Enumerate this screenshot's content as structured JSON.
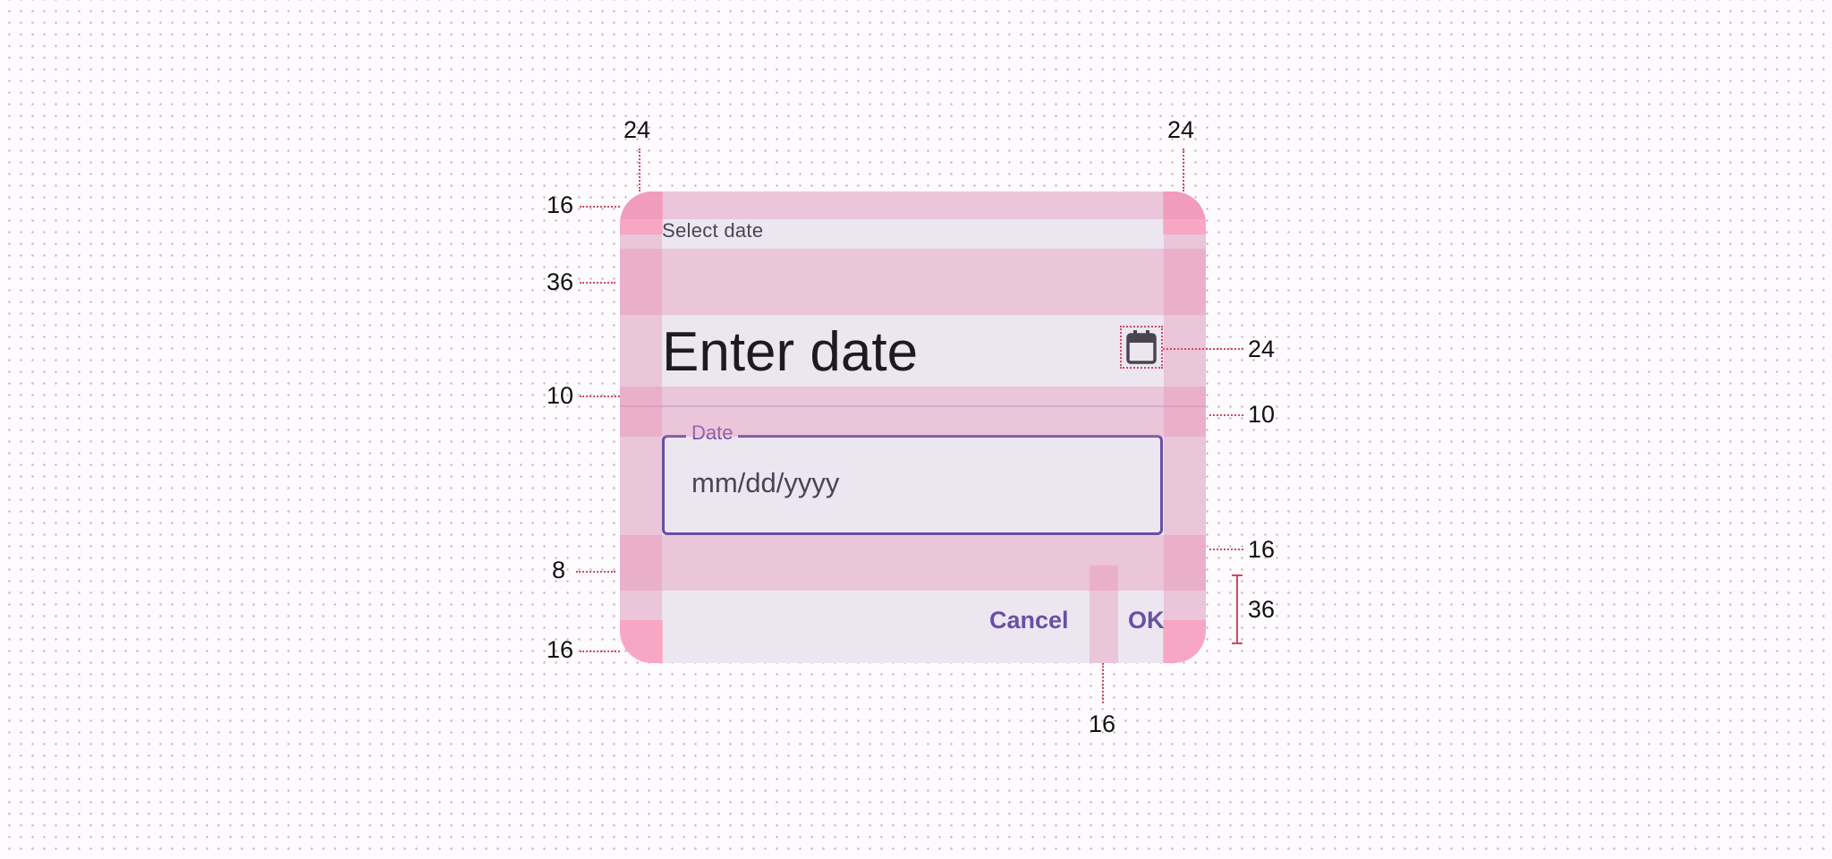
{
  "dialog": {
    "title_label": "Select date",
    "headline": "Enter date",
    "calendar_icon": "calendar-icon",
    "date_field": {
      "label": "Date",
      "placeholder": "mm/dd/yyyy"
    },
    "actions": {
      "cancel_label": "Cancel",
      "ok_label": "OK"
    }
  },
  "spec": {
    "left_padding": "24",
    "right_padding": "24",
    "top_padding": "16",
    "headline_gap": "36",
    "divider_gap_left": "10",
    "icon_size": "24",
    "divider_gap_right": "10",
    "field_bottom_gap": "16",
    "actions_gap": "8",
    "actions_height": "36",
    "bottom_padding": "16",
    "button_gap": "16"
  },
  "colors": {
    "primary": "#6750a4",
    "surface": "#ece6f1",
    "spec_overlay": "#e88ab2",
    "spec_line": "#d2495f"
  }
}
